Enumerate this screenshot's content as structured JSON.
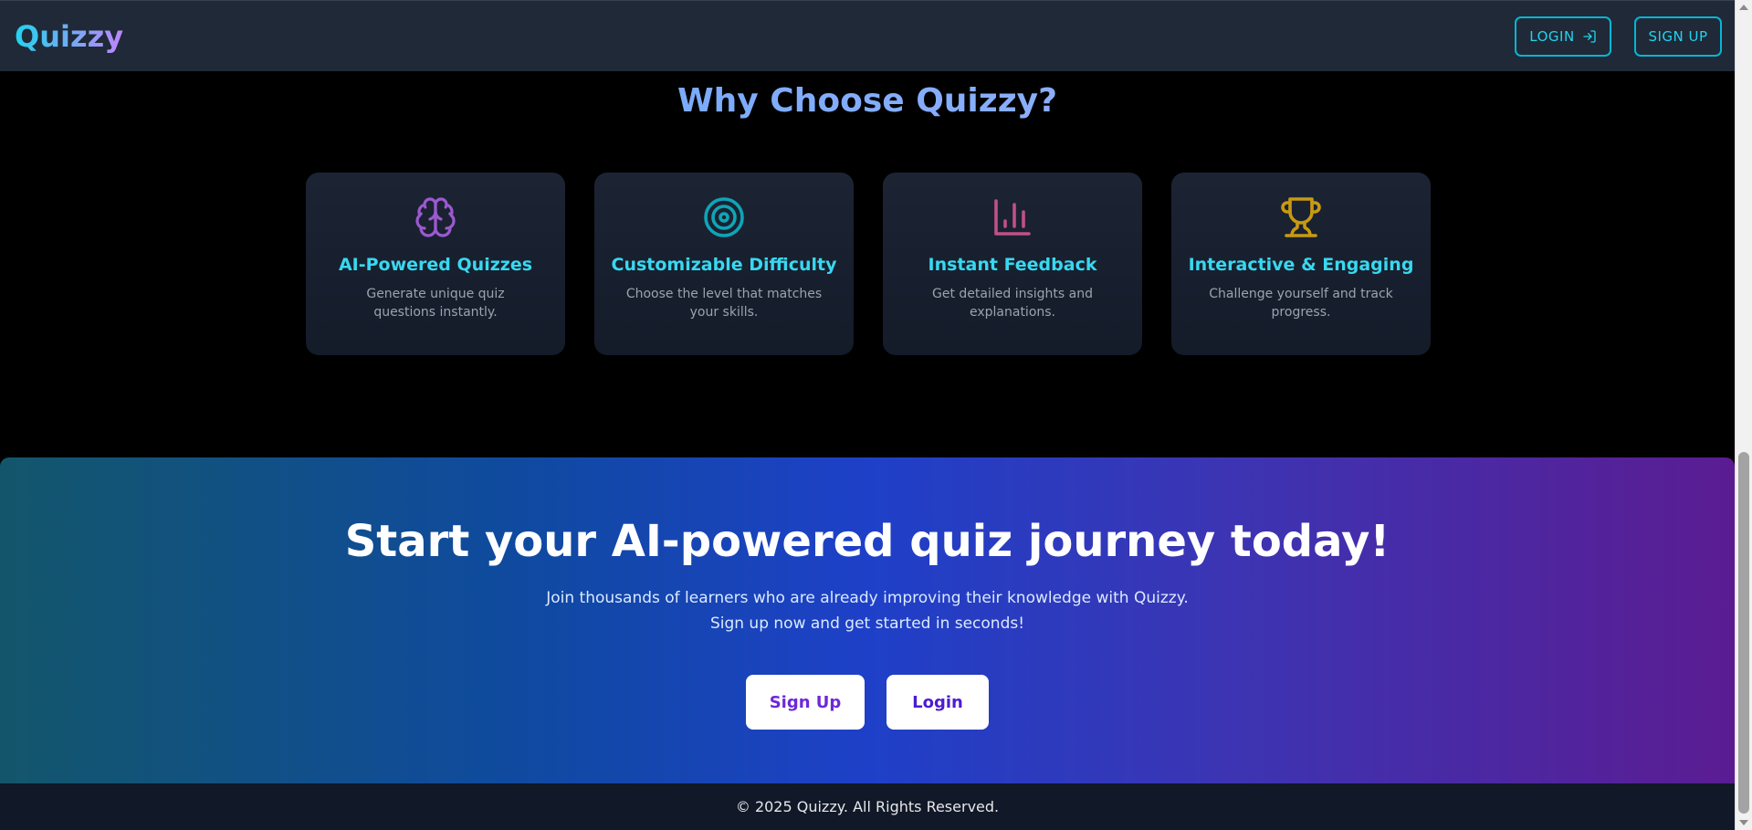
{
  "header": {
    "logo": "Quizzy",
    "login_label": "LOGIN",
    "signup_label": "SIGN UP"
  },
  "features_section": {
    "title": "Why Choose Quizzy?",
    "cards": [
      {
        "icon": "brain-icon",
        "title": "AI-Powered Quizzes",
        "description": "Generate unique quiz questions instantly.",
        "color": "#9b59d0"
      },
      {
        "icon": "target-icon",
        "title": "Customizable Difficulty",
        "description": "Choose the level that matches your skills.",
        "color": "#0ea5b7"
      },
      {
        "icon": "bar-chart-icon",
        "title": "Instant Feedback",
        "description": "Get detailed insights and explanations.",
        "color": "#c0508a"
      },
      {
        "icon": "trophy-icon",
        "title": "Interactive & Engaging",
        "description": "Challenge yourself and track progress.",
        "color": "#c89a10"
      }
    ]
  },
  "cta": {
    "title": "Start your AI-powered quiz journey today!",
    "subtitle": "Join thousands of learners who are already improving their knowledge with Quizzy. Sign up now and get started in seconds!",
    "signup_label": "Sign Up",
    "login_label": "Login"
  },
  "footer": {
    "text": "© 2025 Quizzy. All Rights Reserved."
  },
  "colors": {
    "accent": "#22d3ee",
    "card_title": "#38d8f0",
    "cta_gradient_start": "#13566b",
    "cta_gradient_end": "#5b1c92"
  }
}
